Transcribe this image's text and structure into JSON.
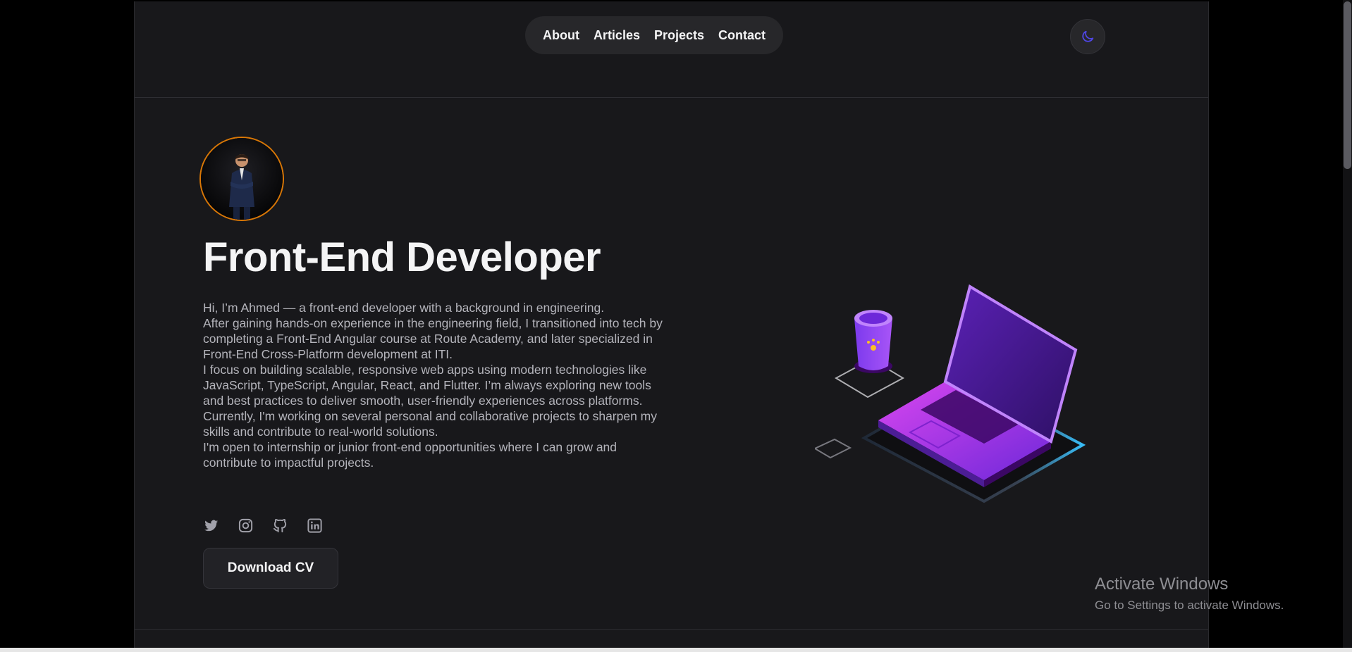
{
  "nav": {
    "items": [
      "About",
      "Articles",
      "Projects",
      "Contact"
    ]
  },
  "theme_toggle": {
    "icon": "moon-icon",
    "accent": "#4f46e5"
  },
  "hero": {
    "title": "Front-End Developer",
    "bio": [
      "Hi, I’m Ahmed — a front-end developer with a background in engineering.",
      "After gaining hands-on experience in the engineering field, I transitioned into tech by completing a Front-End Angular course at Route Academy, and later specialized in Front-End Cross-Platform development at ITI.",
      "I focus on building scalable, responsive web apps using modern technologies like JavaScript, TypeScript, Angular, React, and Flutter. I’m always exploring new tools and best practices to deliver smooth, user-friendly experiences across platforms.",
      "Currently, I'm working on several personal and collaborative projects to sharpen my skills and contribute to real-world solutions.",
      "I'm open to internship or junior front-end opportunities where I can grow and contribute to impactful projects."
    ],
    "socials": [
      "twitter-icon",
      "instagram-icon",
      "github-icon",
      "linkedin-icon"
    ],
    "cv_button": "Download CV"
  },
  "watermark": {
    "line1": "Activate Windows",
    "line2": "Go to Settings to activate Windows."
  },
  "colors": {
    "background": "#18181b",
    "avatar_ring": "#d97706",
    "laptop": "#7c3aed"
  }
}
